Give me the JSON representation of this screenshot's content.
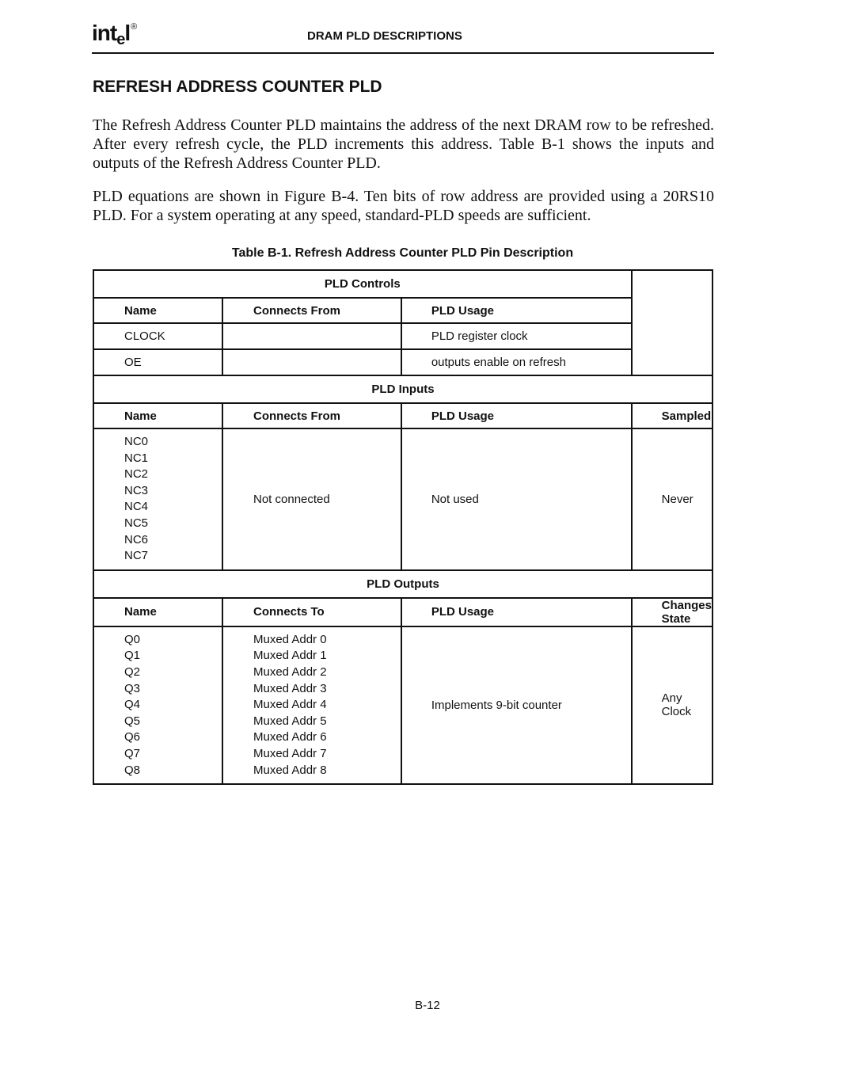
{
  "header": {
    "logo": {
      "prefix": "int",
      "e": "e",
      "suffix": "l",
      "reg": "®"
    },
    "running_head": "DRAM PLD DESCRIPTIONS"
  },
  "section_title": "REFRESH ADDRESS COUNTER PLD",
  "paragraphs": [
    "The Refresh Address Counter PLD maintains the address of the next DRAM row to be refreshed. After every refresh cycle, the PLD increments this address. Table B-1 shows the inputs and outputs of the Refresh Address Counter PLD.",
    "PLD equations are shown in Figure B-4. Ten bits of row address are provided using a 20RS10 PLD. For a system operating at any speed, standard-PLD speeds are sufficient."
  ],
  "table": {
    "caption": "Table B-1.  Refresh Address Counter PLD Pin Description",
    "controls": {
      "title": "PLD Controls",
      "headers": [
        "Name",
        "Connects From",
        "PLD Usage"
      ],
      "rows": [
        {
          "name": "CLOCK",
          "connects": "",
          "usage": "PLD register clock"
        },
        {
          "name": "OE",
          "connects": "",
          "usage": "outputs enable on refresh"
        }
      ]
    },
    "inputs": {
      "title": "PLD Inputs",
      "headers": [
        "Name",
        "Connects From",
        "PLD Usage",
        "Sampled"
      ],
      "names": [
        "NC0",
        "NC1",
        "NC2",
        "NC3",
        "NC4",
        "NC5",
        "NC6",
        "NC7"
      ],
      "connects": "Not connected",
      "usage": "Not used",
      "sampled": "Never"
    },
    "outputs": {
      "title": "PLD Outputs",
      "headers": [
        "Name",
        "Connects To",
        "PLD Usage",
        "Changes State"
      ],
      "names": [
        "Q0",
        "Q1",
        "Q2",
        "Q3",
        "Q4",
        "Q5",
        "Q6",
        "Q7",
        "Q8"
      ],
      "connects": [
        "Muxed Addr 0",
        "Muxed Addr 1",
        "Muxed Addr 2",
        "Muxed Addr 3",
        "Muxed Addr 4",
        "Muxed Addr 5",
        "Muxed Addr 6",
        "Muxed Addr 7",
        "Muxed Addr 8"
      ],
      "usage": "Implements 9-bit counter",
      "changes_state": "Any Clock"
    }
  },
  "footer": {
    "page_number": "B-12"
  }
}
